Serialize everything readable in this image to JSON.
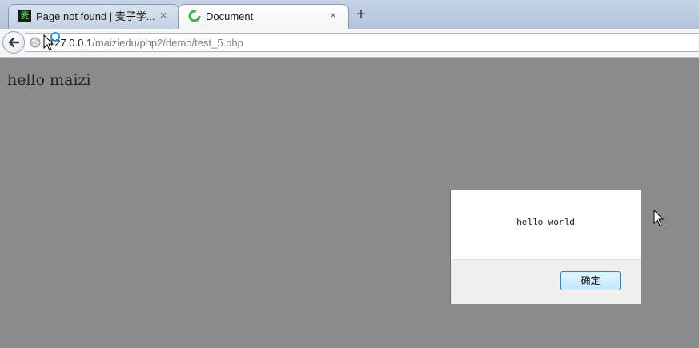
{
  "tabs": [
    {
      "title": "Page not found | 麦子学...",
      "favicon": "麦",
      "close": "×",
      "active": false
    },
    {
      "title": "Document",
      "close": "×",
      "active": true
    }
  ],
  "new_tab": "+",
  "toolbar": {
    "url_host": "127.0.0.1",
    "url_path": "/maiziedu/php2/demo/test_5.php"
  },
  "page": {
    "text": "hello maizi"
  },
  "dialog": {
    "message": "hello world",
    "ok_label": "确定"
  },
  "colors": {
    "page_overlay": "#8a8b8c",
    "button_border": "#3c7fb1",
    "loading_ring": "#3eb34f"
  }
}
